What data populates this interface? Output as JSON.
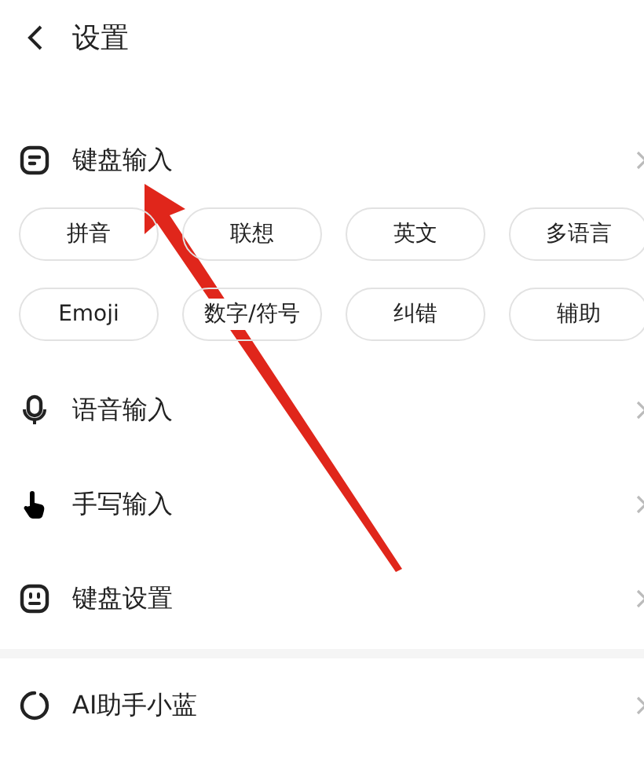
{
  "header": {
    "title": "设置"
  },
  "rows": [
    {
      "label": "键盘输入",
      "chips": [
        "拼音",
        "联想",
        "英文",
        "多语言",
        "Emoji",
        "数字/符号",
        "纠错",
        "辅助"
      ]
    },
    {
      "label": "语音输入"
    },
    {
      "label": "手写输入"
    },
    {
      "label": "键盘设置"
    }
  ],
  "ai_row": {
    "label": "AI助手小蓝"
  }
}
